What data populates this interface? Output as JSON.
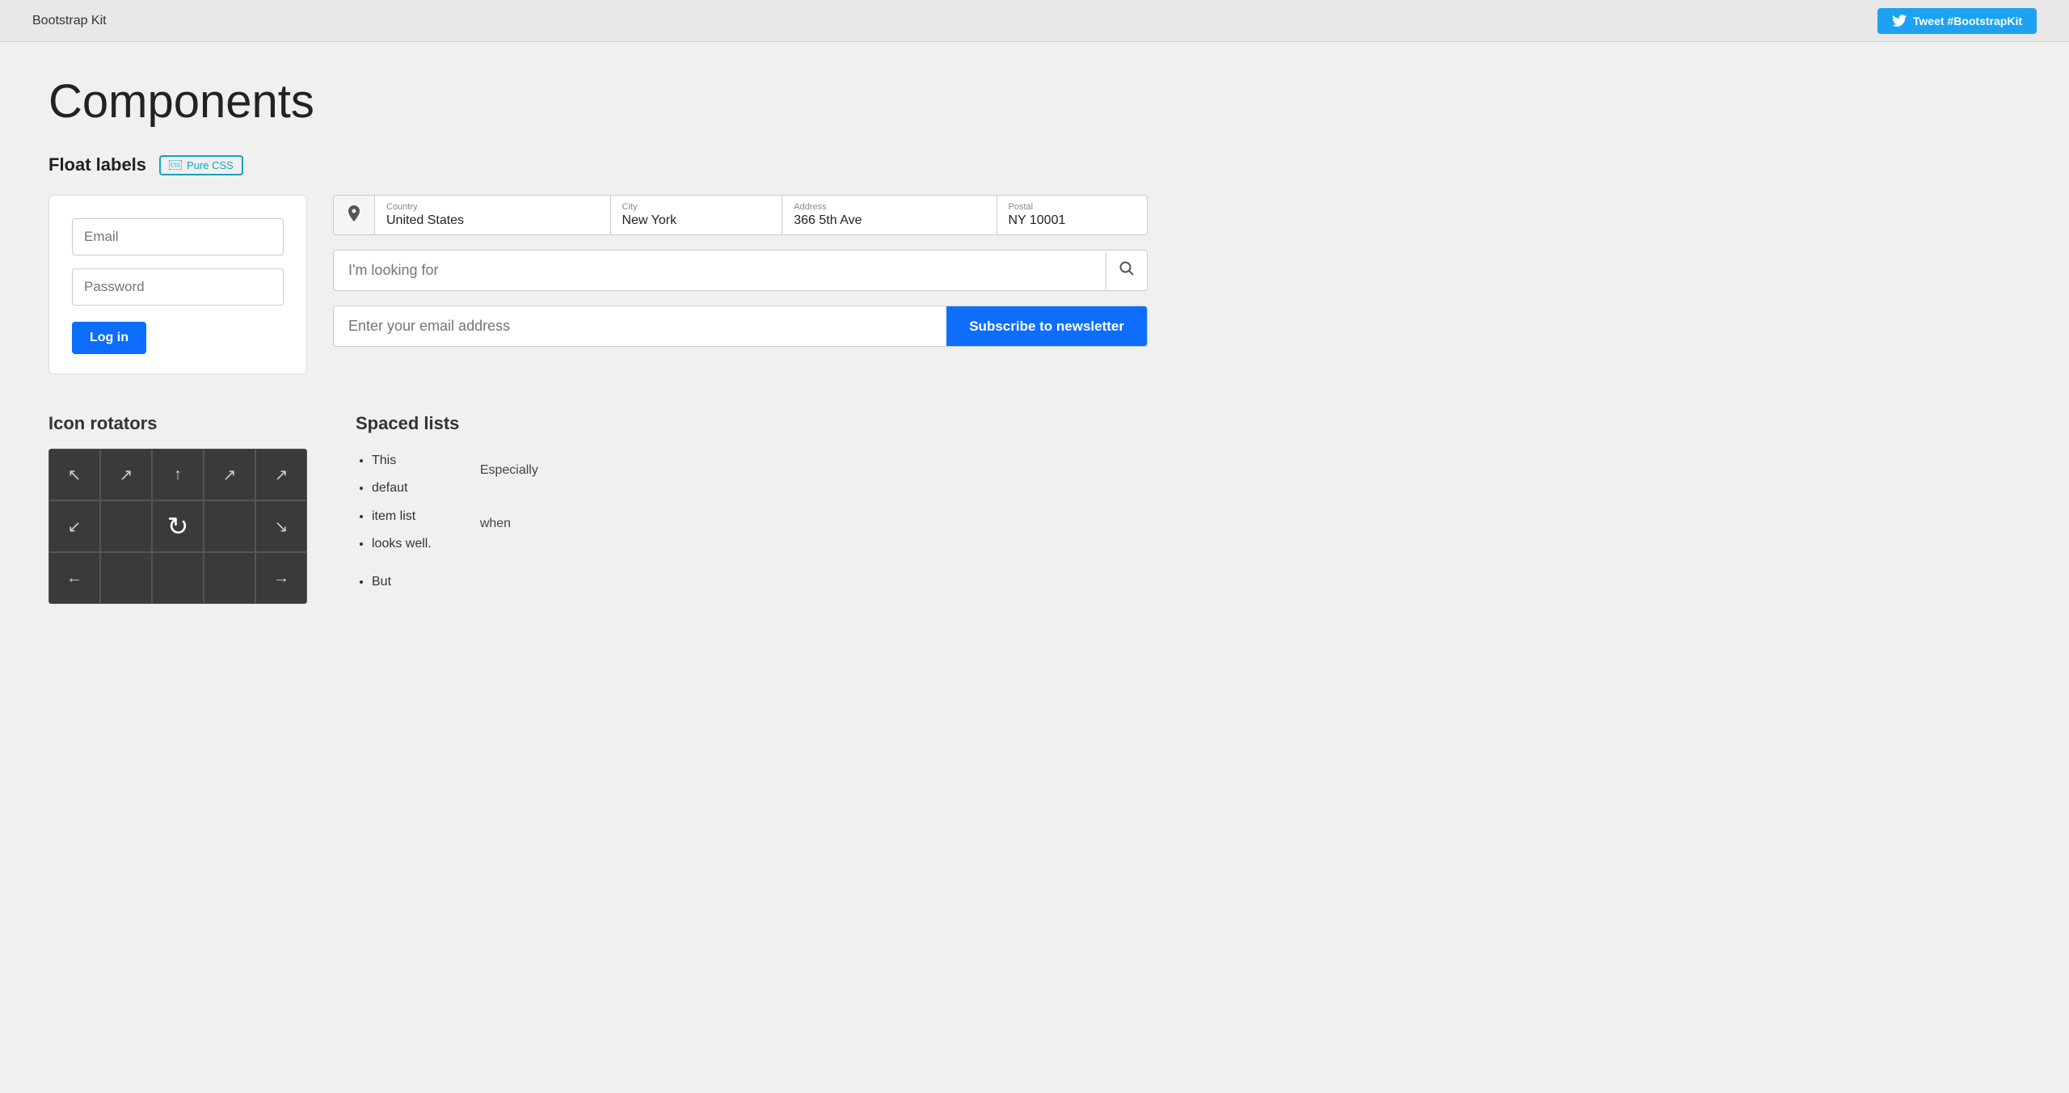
{
  "header": {
    "title": "Bootstrap Kit",
    "tweet_btn": "Tweet #BootstrapKit"
  },
  "page": {
    "title": "Components"
  },
  "float_labels": {
    "section_title": "Float labels",
    "badge": "Pure CSS",
    "login": {
      "email_placeholder": "Email",
      "password_placeholder": "Password",
      "login_btn": "Log in"
    },
    "address": {
      "country_label": "Country",
      "country_value": "United States",
      "city_label": "City",
      "city_value": "New York",
      "address_label": "Address",
      "address_value": "366 5th Ave",
      "postal_label": "Postal",
      "postal_value": "NY 10001"
    },
    "search": {
      "placeholder": "I'm looking for"
    },
    "newsletter": {
      "placeholder": "Enter your email address",
      "btn": "Subscribe to newsletter"
    }
  },
  "icon_rotators": {
    "title": "Icon rotators"
  },
  "spaced_lists": {
    "title": "Spaced lists",
    "items": [
      "This",
      "defaut",
      "item list",
      "looks well.",
      "But"
    ],
    "cards": [
      "Especially",
      "when"
    ]
  }
}
